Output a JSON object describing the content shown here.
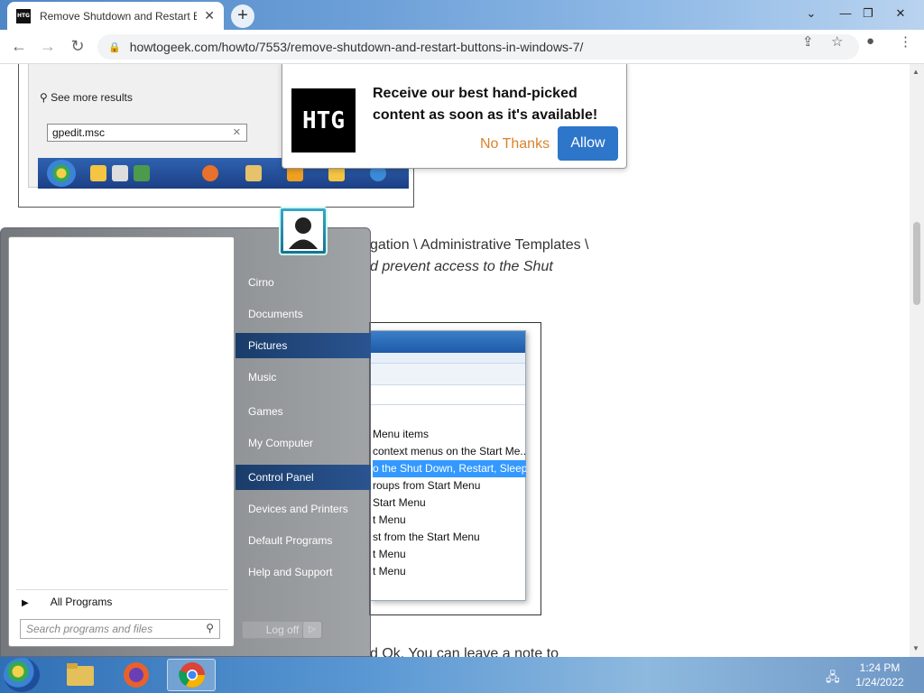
{
  "browser": {
    "tab_title": "Remove Shutdown and Restart B",
    "tab_favicon": "HTG",
    "url": "howtogeek.com/howto/7553/remove-shutdown-and-restart-buttons-in-windows-7/"
  },
  "screenshot1": {
    "see_more": "See more results",
    "search_value": "gpedit.msc"
  },
  "popup": {
    "logo": "HTG",
    "message": "Receive our best hand-picked content as soon as it's available!",
    "no_thanks": "No Thanks",
    "allow": "Allow"
  },
  "article": {
    "line1": "gation \\ Administrative Templates \\",
    "line2": "d prevent access to the Shut",
    "line3": "d Ok. You can leave a note to"
  },
  "gp_items": [
    "Menu items",
    "context menus on the Start Me...",
    "o the Shut Down, Restart, Sleep...",
    "roups from Start Menu",
    "Start Menu",
    "t Menu",
    "st from the Start Menu",
    "t Menu",
    "t Menu"
  ],
  "start_menu": {
    "items": [
      "Cirno",
      "Documents",
      "Pictures",
      "Music",
      "Games",
      "My Computer",
      "Control Panel",
      "Devices and Printers",
      "Default Programs",
      "Help and Support"
    ],
    "all_programs": "All Programs",
    "search_placeholder": "Search programs and files",
    "log_off": "Log off"
  },
  "taskbar": {
    "time": "1:24 PM",
    "date": "1/24/2022"
  },
  "colors": {
    "allow_button": "#2d76c9",
    "no_thanks": "#d9832b",
    "selection": "#3399ff"
  }
}
